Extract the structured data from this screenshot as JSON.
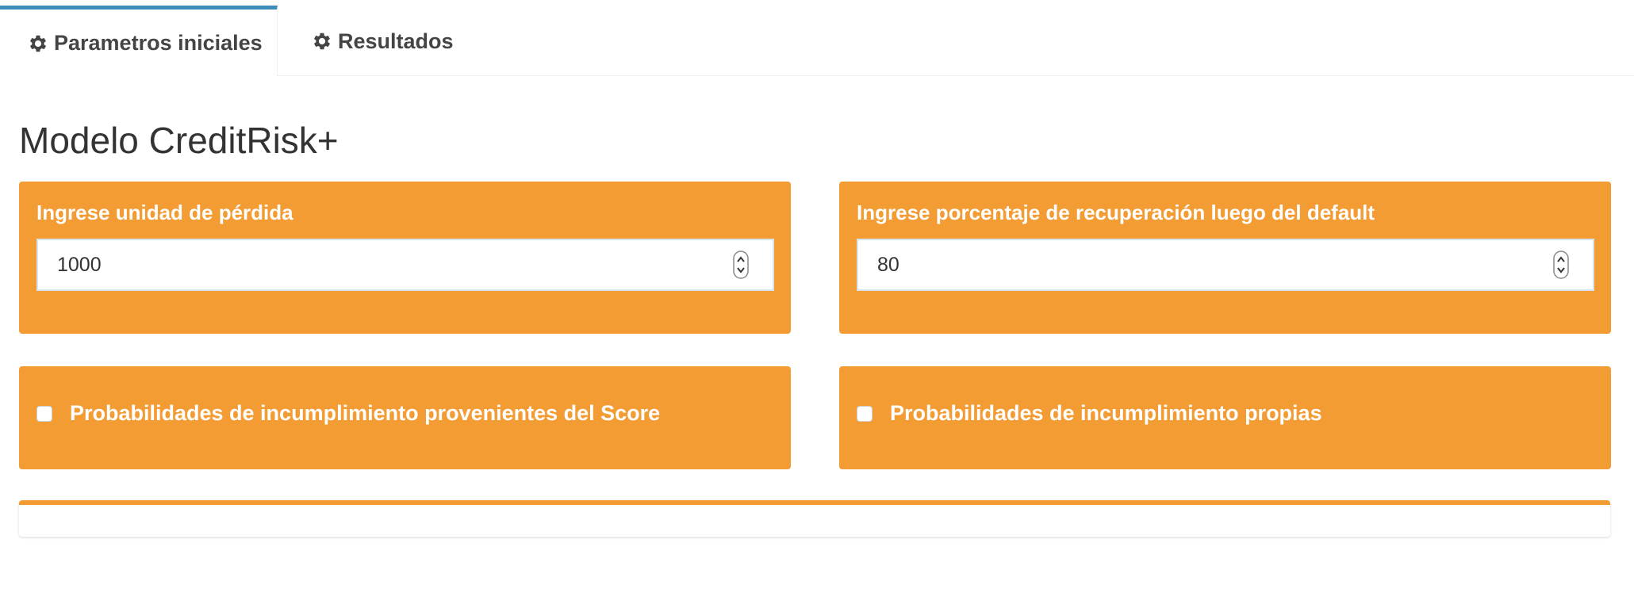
{
  "tabs": [
    {
      "label": "Parametros iniciales",
      "icon": "gear-icon",
      "active": true
    },
    {
      "label": "Resultados",
      "icon": "gear-icon",
      "active": false
    }
  ],
  "page": {
    "title": "Modelo CreditRisk+"
  },
  "inputs": {
    "loss_unit": {
      "label": "Ingrese unidad de pérdida",
      "value": "1000"
    },
    "recovery_pct": {
      "label": "Ingrese porcentaje de recuperación luego del default",
      "value": "80"
    }
  },
  "checkboxes": {
    "score_pd": {
      "label": "Probabilidades de incumplimiento provenientes del Score",
      "checked": false
    },
    "own_pd": {
      "label": "Probabilidades de incumplimiento propias",
      "checked": false
    }
  },
  "colors": {
    "accent": "#f39c34",
    "tab_active_border": "#3c8dbc"
  }
}
